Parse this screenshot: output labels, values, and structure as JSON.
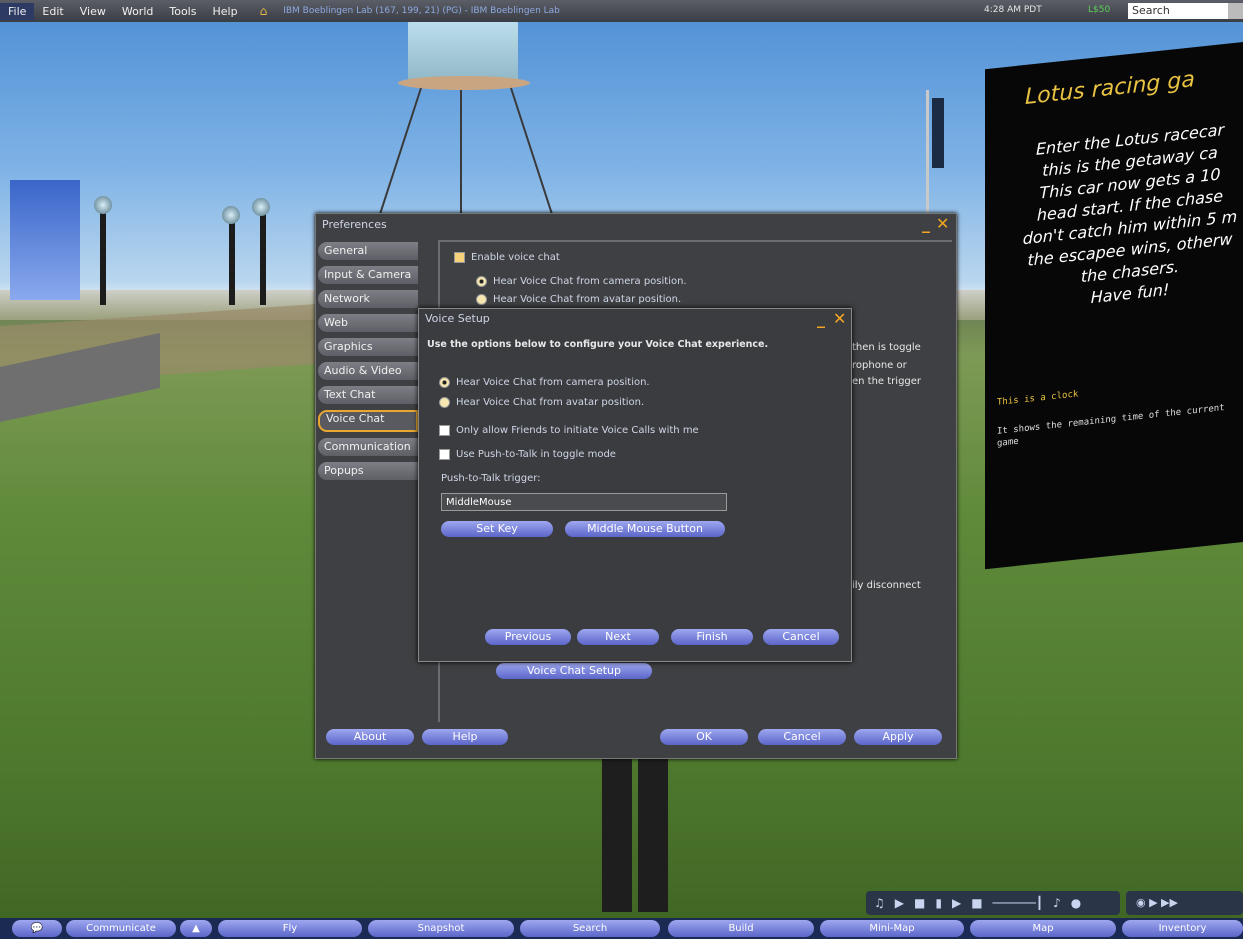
{
  "menubar": {
    "items": [
      "File",
      "Edit",
      "View",
      "World",
      "Tools",
      "Help"
    ],
    "location": "IBM Boeblingen Lab (167, 199, 21) (PG) - IBM Boeblingen Lab",
    "time": "4:28 AM PDT",
    "balance": "L$50",
    "search_placeholder": "Search"
  },
  "scene_sign": {
    "title": "Lotus racing ga",
    "body": [
      "Enter the Lotus racecar",
      "this is the getaway ca",
      "This car now gets a 10",
      "head start. If the chase",
      "don't catch him within 5 m",
      "the escapee wins, otherw",
      "the chasers.",
      "Have fun!"
    ],
    "clock_title": "This is a clock",
    "clock_note": "It shows the remaining time of the current game"
  },
  "preferences": {
    "title": "Preferences",
    "tabs": [
      "General",
      "Input & Camera",
      "Network",
      "Web",
      "Graphics",
      "Audio & Video",
      "Text Chat",
      "Voice Chat",
      "Communication",
      "Popups"
    ],
    "active_tab": "Voice Chat",
    "enable_voice": "Enable voice chat",
    "radio_camera": "Hear Voice Chat from camera position.",
    "radio_avatar": "Hear Voice Chat from avatar position.",
    "frag_toggle": "then is toggle",
    "frag_mic": "rophone or",
    "frag_trigger": "en the trigger",
    "frag_disconnect": "ily disconnect",
    "voice_setup_button": "Voice Chat Setup",
    "buttons": {
      "about": "About",
      "help": "Help",
      "ok": "OK",
      "cancel": "Cancel",
      "apply": "Apply"
    }
  },
  "voice_setup": {
    "title": "Voice Setup",
    "instructions": "Use the options below to configure your Voice Chat experience.",
    "radio_camera": "Hear Voice Chat from camera position.",
    "radio_avatar": "Hear Voice Chat from avatar position.",
    "friends_only": "Only allow Friends to initiate Voice Calls with me",
    "push_toggle": "Use Push-to-Talk in toggle mode",
    "trigger_label": "Push-to-Talk trigger:",
    "trigger_value": "MiddleMouse",
    "set_key": "Set Key",
    "middle_mouse": "Middle Mouse Button",
    "previous": "Previous",
    "next": "Next",
    "finish": "Finish",
    "cancel": "Cancel"
  },
  "bottom_bar": {
    "buttons": [
      "Communicate",
      "Fly",
      "Snapshot",
      "Search",
      "Build",
      "Mini-Map",
      "Map",
      "Inventory"
    ]
  },
  "colors": {
    "accent": "#e8a733",
    "button": "#7a84df",
    "menubar": "#3a3d44"
  }
}
